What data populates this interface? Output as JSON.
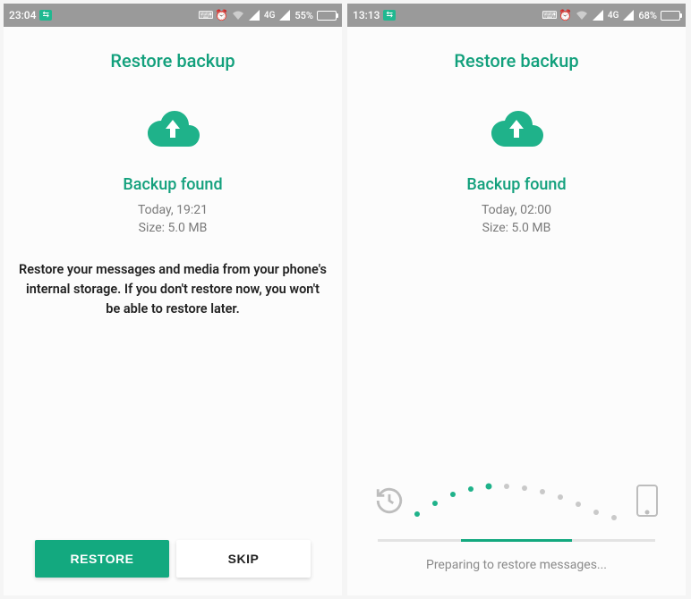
{
  "left": {
    "statusbar": {
      "time": "23:04",
      "network": "4G",
      "battery_text": "55%",
      "battery_fill_pct": 55
    },
    "title": "Restore backup",
    "subtitle": "Backup found",
    "meta_time": "Today, 19:21",
    "meta_size": "Size: 5.0 MB",
    "description": "Restore your messages and media from your phone's internal storage. If you don't restore now, you won't be able to restore later.",
    "restore_label": "RESTORE",
    "skip_label": "SKIP"
  },
  "right": {
    "statusbar": {
      "time": "13:13",
      "network": "4G",
      "battery_text": "68%",
      "battery_fill_pct": 68
    },
    "title": "Restore backup",
    "subtitle": "Backup found",
    "meta_time": "Today, 02:00",
    "meta_size": "Size: 5.0 MB",
    "progress_text": "Preparing to restore messages..."
  },
  "colors": {
    "accent": "#12a07c",
    "button": "#13a97f"
  }
}
